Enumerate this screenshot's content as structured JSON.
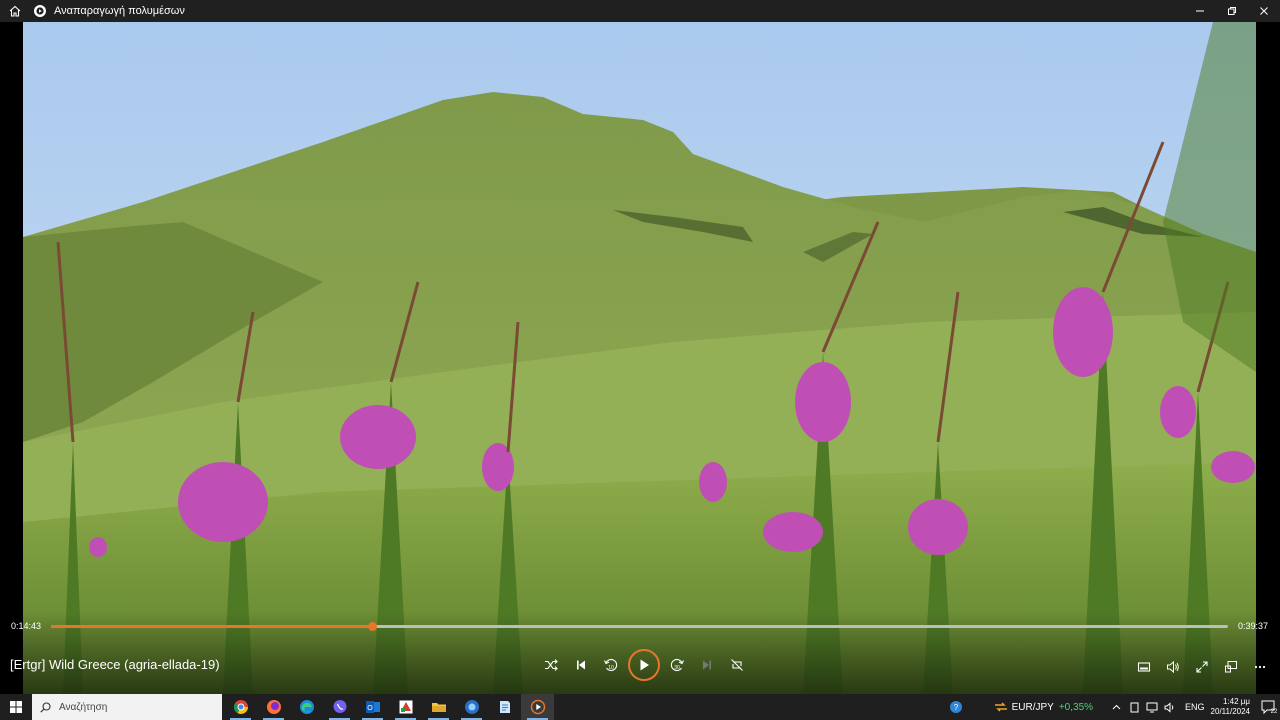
{
  "window": {
    "title": "Αναπαραγωγή πολυμέσων",
    "icons": {
      "home": "home-icon",
      "app": "media-player-icon"
    }
  },
  "player": {
    "current_time": "0:14:43",
    "total_time": "0:39:37",
    "progress": 0.2731,
    "media_title": "[Ertgr] Wild Greece (agria-ellada-19)",
    "accent_color": "#e8752a",
    "controls": [
      "shuffle-icon",
      "previous-icon",
      "rewind-10-icon",
      "play-icon",
      "forward-30-icon",
      "next-icon",
      "repeat-off-icon"
    ],
    "right_controls": [
      "miniplayer-icon",
      "volume-icon",
      "fullscreen-icon",
      "cast-icon",
      "more-icon"
    ],
    "rewind_label": "10",
    "forward_label": "30"
  },
  "taskbar": {
    "search_placeholder": "Αναζήτηση",
    "apps": [
      "chrome-icon",
      "firefox-icon",
      "edge-icon",
      "viber-icon",
      "outlook-icon",
      "media-app-icon",
      "file-explorer-icon",
      "edge-beta-icon",
      "notepad-icon",
      "media-player-icon"
    ],
    "ticker_pair": "EUR/JPY",
    "ticker_change": "+0,35%",
    "language": "ENG",
    "time": "1:42 μμ",
    "date": "20/11/2024",
    "notifications_count": "22"
  }
}
